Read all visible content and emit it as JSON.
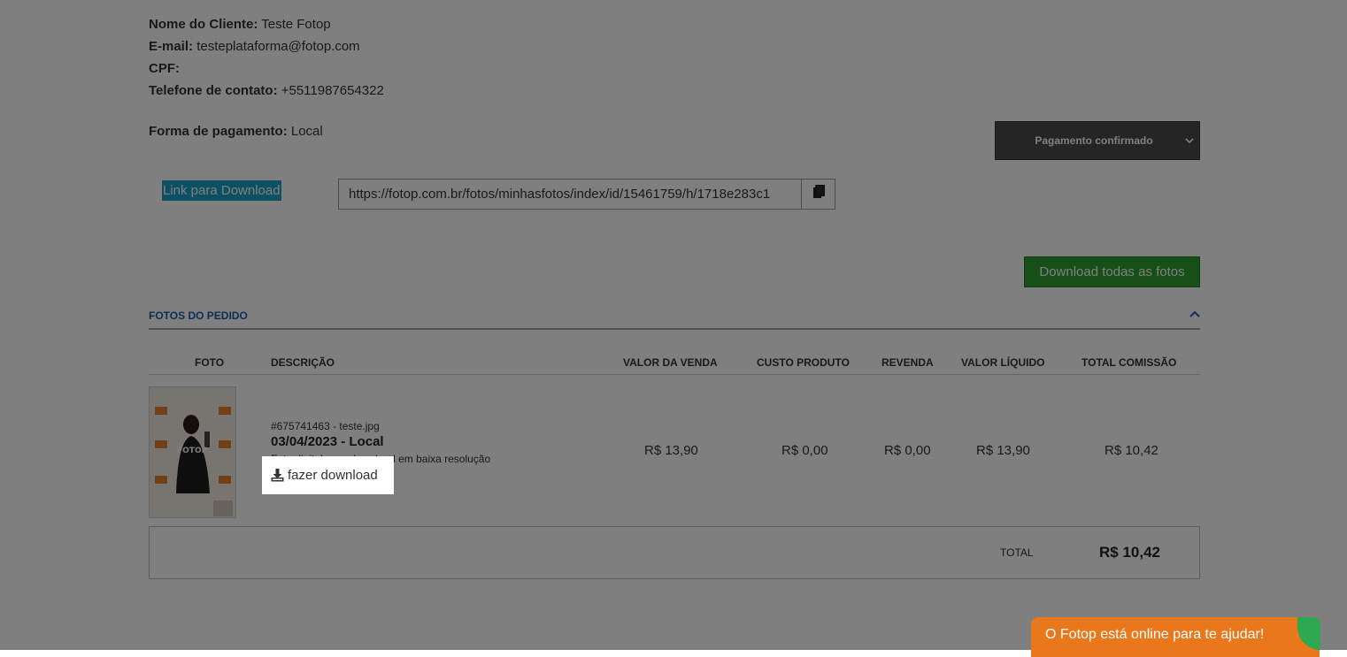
{
  "customer": {
    "name_label": "Nome do Cliente:",
    "name_value": "Teste Fotop",
    "email_label": "E-mail:",
    "email_value": "testeplataforma@fotop.com",
    "cpf_label": "CPF:",
    "cpf_value": "",
    "phone_label": "Telefone de contato:",
    "phone_value": "+5511987654322"
  },
  "payment": {
    "method_label": "Forma de pagamento:",
    "method_value": "Local",
    "status_selected": "Pagamento confirmado"
  },
  "download": {
    "link_label": "Link para Download",
    "url": "https://fotop.com.br/fotos/minhasfotos/index/id/15461759/h/1718e283c1",
    "download_all_label": "Download todas as fotos"
  },
  "section": {
    "title": "FOTOS DO PEDIDO"
  },
  "table": {
    "headers": {
      "foto": "FOTO",
      "descricao": "DESCRIÇÃO",
      "valor_venda": "VALOR DA VENDA",
      "custo_produto": "CUSTO PRODUTO",
      "revenda": "REVENDA",
      "valor_liquido": "VALOR LÍQUIDO",
      "total_comissao": "TOTAL COMISSÃO"
    },
    "rows": [
      {
        "thumb_text": "FOTOP",
        "file": "#675741463 - teste.jpg",
        "event": "03/04/2023 - Local",
        "product": "Foto digital para download em baixa resolução",
        "download_label": "fazer download",
        "valor_venda": "R$ 13,90",
        "custo_produto": "R$ 0,00",
        "revenda": "R$ 0,00",
        "valor_liquido": "R$ 13,90",
        "total_comissao": "R$ 10,42"
      }
    ],
    "total_label": "TOTAL",
    "total_value": "R$ 10,42"
  },
  "chat": {
    "label": "O Fotop está online para te ajudar!"
  },
  "colors": {
    "overlay": "#000000",
    "link_label_bg": "#1ba1c9",
    "download_all_bg": "#2e9f33",
    "status_bg": "#4a4a4a",
    "section_title": "#1c5fa8",
    "chat_bg": "#e8781b",
    "chat_accent": "#2fa84f"
  }
}
